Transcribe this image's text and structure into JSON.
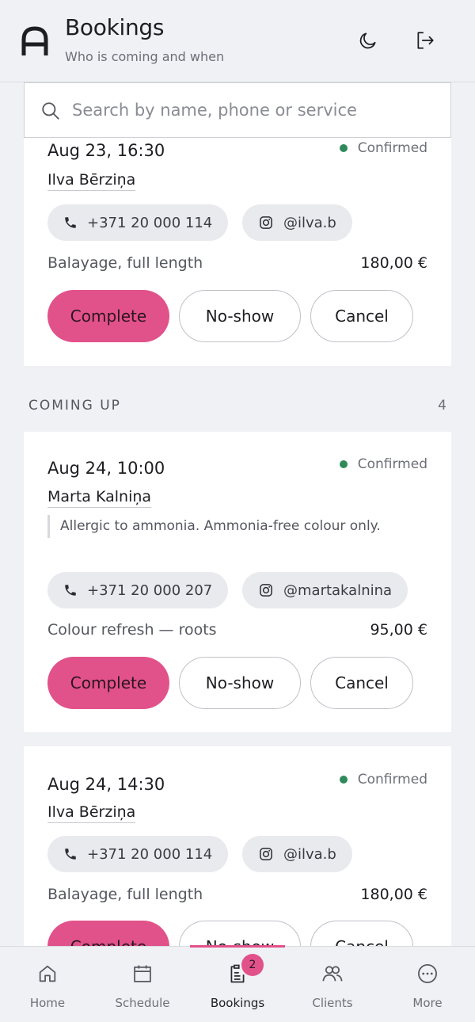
{
  "header": {
    "title": "Bookings",
    "subtitle": "Who is coming and when"
  },
  "search": {
    "placeholder": "Search by name, phone or service"
  },
  "section": {
    "label": "COMING UP",
    "count": "4"
  },
  "bookings": [
    {
      "date": "Aug 23, 16:30",
      "status": "Confirmed",
      "client": "Ilva Bērziņa",
      "note": "",
      "phone": "+371 20 000 114",
      "instagram": "@ilva.b",
      "service": "Balayage, full length",
      "price": "180,00 €",
      "actions": {
        "complete": "Complete",
        "no_show": "No-show",
        "cancel": "Cancel"
      }
    },
    {
      "date": "Aug 24, 10:00",
      "status": "Confirmed",
      "client": "Marta Kalniņa",
      "note": "Allergic to ammonia. Ammonia-free colour only.",
      "phone": "+371 20 000 207",
      "instagram": "@martakalnina",
      "service": "Colour refresh — roots",
      "price": "95,00 €",
      "actions": {
        "complete": "Complete",
        "no_show": "No-show",
        "cancel": "Cancel"
      }
    },
    {
      "date": "Aug 24, 14:30",
      "status": "Confirmed",
      "client": "Ilva Bērziņa",
      "note": "",
      "phone": "+371 20 000 114",
      "instagram": "@ilva.b",
      "service": "Balayage, full length",
      "price": "180,00 €",
      "actions": {
        "complete": "Complete",
        "no_show": "No-show",
        "cancel": "Cancel"
      }
    }
  ],
  "tabbar": {
    "items": [
      {
        "label": "Home",
        "icon": "home-icon"
      },
      {
        "label": "Schedule",
        "icon": "calendar-icon"
      },
      {
        "label": "Bookings",
        "icon": "clipboard-icon",
        "badge": "2",
        "active": true
      },
      {
        "label": "Clients",
        "icon": "users-icon"
      },
      {
        "label": "More",
        "icon": "more-icon"
      }
    ]
  },
  "colors": {
    "accent": "#e2528a",
    "confirmed": "#2f8a5a",
    "background": "#f0f1f4"
  }
}
